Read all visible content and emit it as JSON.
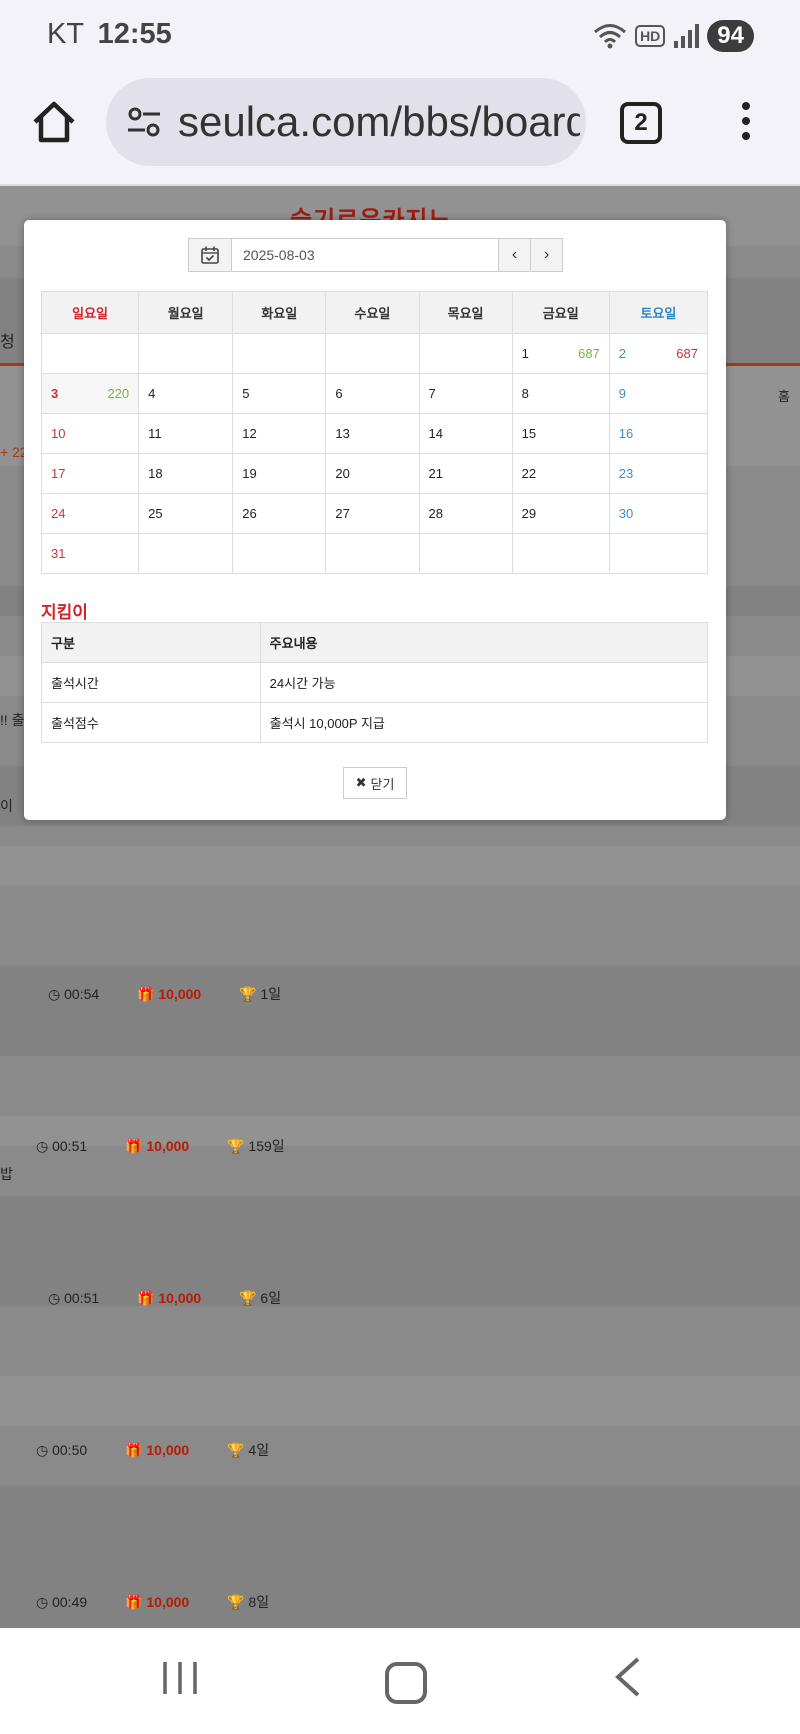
{
  "status_bar": {
    "carrier": "KT",
    "time": "12:55",
    "hd_label": "HD",
    "battery": "94"
  },
  "browser": {
    "url": "seulca.com/bbs/board",
    "tab_count": "2"
  },
  "background": {
    "logo_fragment": "슬기로운카지노",
    "edge_texts": [
      "청",
      "+ 22",
      "홈",
      "!! 출",
      "이",
      "밥"
    ],
    "rows": [
      {
        "time": "00:54",
        "points": "10,000",
        "days": "1일"
      },
      {
        "time": "00:51",
        "points": "10,000",
        "days": "159일"
      },
      {
        "time": "00:51",
        "points": "10,000",
        "days": "6일"
      },
      {
        "time": "00:50",
        "points": "10,000",
        "days": "4일"
      },
      {
        "time": "00:49",
        "points": "10,000",
        "days": "8일"
      }
    ]
  },
  "modal": {
    "date_value": "2025-08-03",
    "weekdays": [
      "일요일",
      "월요일",
      "화요일",
      "수요일",
      "목요일",
      "금요일",
      "토요일"
    ],
    "weeks": [
      [
        {
          "d": ""
        },
        {
          "d": ""
        },
        {
          "d": ""
        },
        {
          "d": ""
        },
        {
          "d": ""
        },
        {
          "d": "1",
          "c": "687",
          "cc": "green"
        },
        {
          "d": "2",
          "c": "687",
          "cc": "red"
        }
      ],
      [
        {
          "d": "3",
          "c": "220",
          "cc": "green",
          "today": true
        },
        {
          "d": "4"
        },
        {
          "d": "5"
        },
        {
          "d": "6"
        },
        {
          "d": "7"
        },
        {
          "d": "8"
        },
        {
          "d": "9"
        }
      ],
      [
        {
          "d": "10"
        },
        {
          "d": "11"
        },
        {
          "d": "12"
        },
        {
          "d": "13"
        },
        {
          "d": "14"
        },
        {
          "d": "15"
        },
        {
          "d": "16"
        }
      ],
      [
        {
          "d": "17"
        },
        {
          "d": "18"
        },
        {
          "d": "19"
        },
        {
          "d": "20"
        },
        {
          "d": "21"
        },
        {
          "d": "22"
        },
        {
          "d": "23"
        }
      ],
      [
        {
          "d": "24"
        },
        {
          "d": "25"
        },
        {
          "d": "26"
        },
        {
          "d": "27"
        },
        {
          "d": "28"
        },
        {
          "d": "29"
        },
        {
          "d": "30"
        }
      ],
      [
        {
          "d": "31"
        },
        {
          "d": ""
        },
        {
          "d": ""
        },
        {
          "d": ""
        },
        {
          "d": ""
        },
        {
          "d": ""
        },
        {
          "d": ""
        }
      ]
    ],
    "section_title": "지킴이",
    "info_headers": [
      "구분",
      "주요내용"
    ],
    "info_rows": [
      [
        "출석시간",
        "24시간 가능"
      ],
      [
        "출석점수",
        "출석시 10,000P 지급"
      ]
    ],
    "close_label": "닫기"
  }
}
